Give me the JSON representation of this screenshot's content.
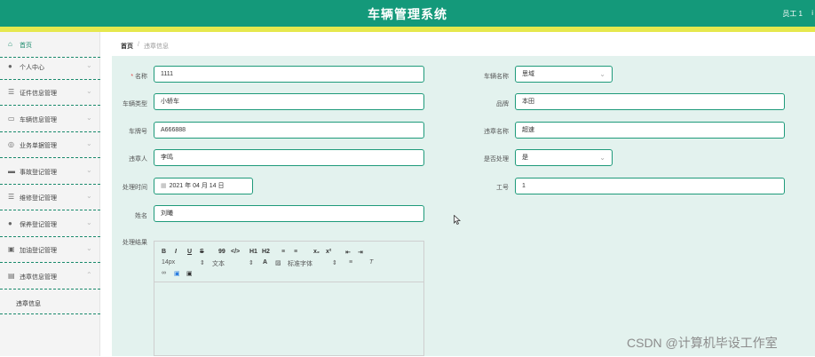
{
  "header": {
    "title": "车辆管理系统",
    "user": "员工 1",
    "user_extra": "i"
  },
  "sidebar": {
    "items": [
      {
        "label": "首页",
        "icon": "home-icon"
      },
      {
        "label": "个人中心",
        "icon": "user-icon"
      },
      {
        "label": "证件信息管理",
        "icon": "list-icon"
      },
      {
        "label": "车辆信息管理",
        "icon": "chat-icon"
      },
      {
        "label": "业务单据管理",
        "icon": "settings-icon"
      },
      {
        "label": "事故登记管理",
        "icon": "car-icon"
      },
      {
        "label": "维修登记管理",
        "icon": "list-icon"
      },
      {
        "label": "保养登记管理",
        "icon": "user-icon"
      },
      {
        "label": "加油登记管理",
        "icon": "fuel-icon"
      },
      {
        "label": "违章信息管理",
        "icon": "doc-icon"
      }
    ],
    "sub_item": "违章信息"
  },
  "breadcrumb": {
    "home": "首页",
    "separator": "/",
    "current": "违章信息"
  },
  "form": {
    "name": {
      "label": "名称",
      "required_mark": "*",
      "value": "1111"
    },
    "vehicle_name": {
      "label": "车辆名称",
      "value": "思域"
    },
    "vehicle_type": {
      "label": "车辆类型",
      "value": "小轿车"
    },
    "brand": {
      "label": "品牌",
      "value": "本田"
    },
    "plate": {
      "label": "车牌号",
      "value": "A666888"
    },
    "violation_name": {
      "label": "违章名称",
      "value": "超速"
    },
    "violator": {
      "label": "违章人",
      "value": "李鸣"
    },
    "handled": {
      "label": "是否处理",
      "value": "是"
    },
    "handle_time": {
      "label": "处理时间",
      "value": "2021 年 04 月 14 日"
    },
    "employee_no": {
      "label": "工号",
      "value": "1"
    },
    "full_name": {
      "label": "姓名",
      "value": "刘曦"
    },
    "result": {
      "label": "处理结果"
    }
  },
  "editor": {
    "buttons": [
      "B",
      "I",
      "U",
      "S",
      "99",
      "</>",
      "H1",
      "H2",
      "≡",
      "≡",
      "x₂",
      "x²",
      "⇤",
      "⇥"
    ],
    "font_size": "14px",
    "text_style": "文本",
    "font_family": "标准字体"
  },
  "watermark": "CSDN @计算机毕设工作室"
}
